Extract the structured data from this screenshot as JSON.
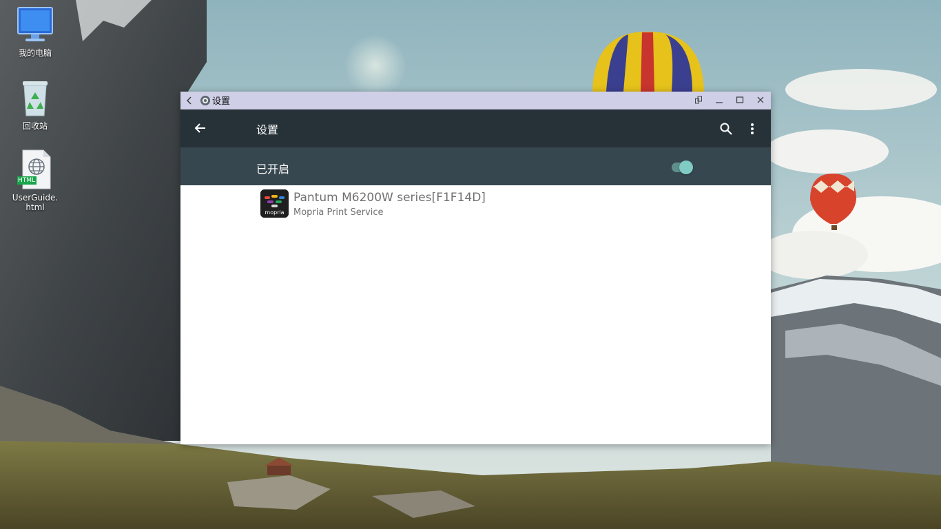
{
  "desktop": {
    "icons": [
      {
        "label": "我的电脑",
        "icon": "computer-icon"
      },
      {
        "label": "回收站",
        "icon": "recycle-bin-icon"
      },
      {
        "label": "UserGuide.html",
        "icon": "html-file-icon",
        "badge": "HTML"
      }
    ]
  },
  "window": {
    "title": "设置",
    "titlebar_icons": [
      "back-icon",
      "settings-gear-icon",
      "rotate-icon",
      "minimize-icon",
      "maximize-icon",
      "close-icon"
    ]
  },
  "appbar": {
    "title": "设置",
    "icons": [
      "arrow-back-icon",
      "search-icon",
      "more-vert-icon"
    ]
  },
  "service_switch": {
    "label": "已开启",
    "state": "on"
  },
  "printers": [
    {
      "name": "Pantum M6200W series[F1F14D]",
      "service": "Mopria Print Service",
      "icon": "mopria-icon",
      "icon_text": "mopria"
    }
  ],
  "colors": {
    "titlebar": "#cfcfe8",
    "appbar": "#263238",
    "switchbar": "#37474f",
    "switch_on": "#80cbc4"
  }
}
